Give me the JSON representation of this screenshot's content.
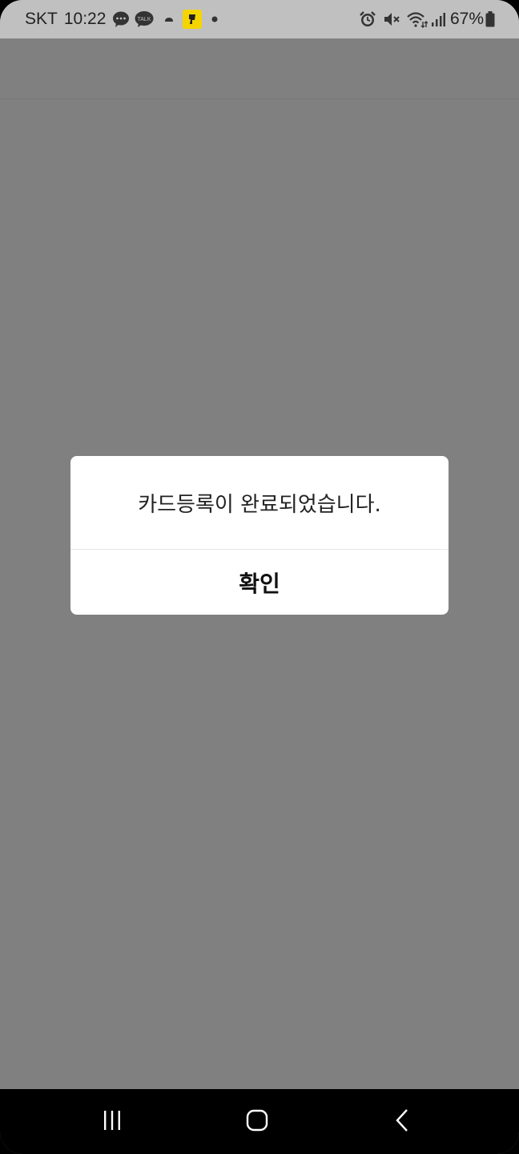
{
  "status_bar": {
    "carrier": "SKT",
    "time": "10:22",
    "battery_percent": "67%",
    "left_icons": [
      "message-icon",
      "kakaotalk-icon",
      "cloud-icon",
      "app-notification-icon",
      "dot-icon"
    ],
    "right_icons": [
      "alarm-icon",
      "mute-icon",
      "wifi-icon",
      "signal-icon",
      "battery-icon"
    ],
    "talk_label": "TALK"
  },
  "dialog": {
    "message": "카드등록이 완료되었습니다.",
    "confirm_label": "확인"
  },
  "nav_bar": {
    "icons": [
      "recent-apps-icon",
      "home-icon",
      "back-icon"
    ]
  },
  "colors": {
    "overlay": "#808080",
    "status_bar_bg": "#c0c0c0",
    "dialog_bg": "#ffffff",
    "nav_bar_bg": "#000000"
  }
}
